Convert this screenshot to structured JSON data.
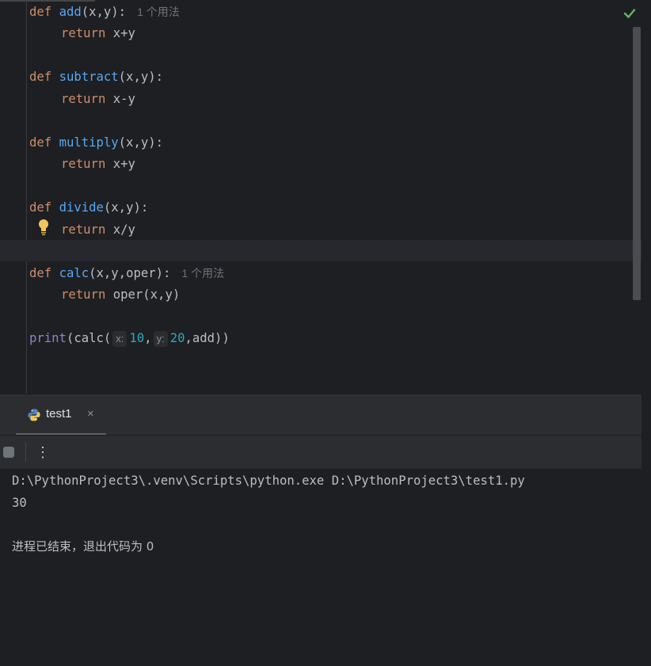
{
  "editor": {
    "lines": [
      {
        "kw": "def",
        "fn": "add",
        "rest": "(x,y):",
        "hint": "1 个用法"
      },
      {
        "kw": "return",
        "rest": " x+y"
      },
      {
        "kw": "def",
        "fn": "subtract",
        "rest": "(x,y):"
      },
      {
        "kw": "return",
        "rest": " x-y"
      },
      {
        "kw": "def",
        "fn": "multiply",
        "rest": "(x,y):"
      },
      {
        "kw": "return",
        "rest": " x+y"
      },
      {
        "kw": "def",
        "fn": "divide",
        "rest": "(x,y):"
      },
      {
        "kw": "return",
        "rest": " x/y"
      },
      {
        "kw": "def",
        "fn": "calc",
        "rest": "(x,y,oper):",
        "hint": "1 个用法"
      },
      {
        "kw": "return",
        "rest": " oper(x,y)"
      }
    ],
    "print_line": {
      "builtin": "print",
      "open": "(calc(",
      "hint_x": "x:",
      "val_x": "10",
      "comma": ",",
      "hint_y": "y:",
      "val_y": "20",
      "tail": ",add))"
    },
    "status_icon": "check-icon",
    "gutter_icon": "lightbulb-icon"
  },
  "run_panel": {
    "tab_label": "test1",
    "tab_close": "×",
    "tab_icon": "python-icon",
    "more_label": "⋮"
  },
  "console": {
    "command": "D:\\PythonProject3\\.venv\\Scripts\\python.exe D:\\PythonProject3\\test1.py",
    "output": "30",
    "exit_message": "进程已结束，退出代码为 0"
  },
  "colors": {
    "background": "#1e1f22",
    "keyword": "#cf8e6d",
    "function": "#56a8f5",
    "builtin": "#8888c6",
    "number": "#2aacb8",
    "text": "#bcbec4",
    "success": "#5fb865"
  }
}
